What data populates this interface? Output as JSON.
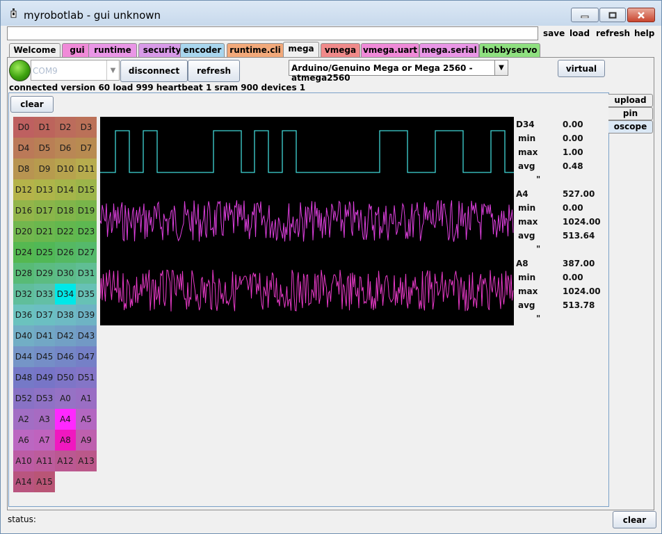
{
  "window": {
    "title": "myrobotlab - gui unknown"
  },
  "toolbar": {
    "command_value": "",
    "save": "save",
    "load": "load",
    "refresh": "refresh",
    "help": "help"
  },
  "tabs": [
    {
      "label": "Welcome",
      "color": "#f0f0f0"
    },
    {
      "label": "gui",
      "color": "#f08ad8"
    },
    {
      "label": "runtime",
      "color": "#e996e6"
    },
    {
      "label": "security",
      "color": "#d89ae8"
    },
    {
      "label": "encoder",
      "color": "#a9d6ee"
    },
    {
      "label": "runtime.cli",
      "color": "#f2a97a"
    },
    {
      "label": "mega",
      "color": "#f0f0f0",
      "active": true
    },
    {
      "label": "vmega",
      "color": "#f08a8a"
    },
    {
      "label": "vmega.uart",
      "color": "#f08ad8"
    },
    {
      "label": "mega.serial",
      "color": "#e996e6"
    },
    {
      "label": "hobbyservo",
      "color": "#8fe080"
    }
  ],
  "controls": {
    "port_value": "COM9",
    "disconnect": "disconnect",
    "refresh": "refresh",
    "board": "Arduino/Genuino Mega or Mega 2560 - atmega2560",
    "virtual": "virtual",
    "status_line": "connected version 60 load 999 heartbeat 1 sram 900 devices 1",
    "clear": "clear"
  },
  "side_tabs": [
    {
      "label": "upload"
    },
    {
      "label": "pin"
    },
    {
      "label": "oscope",
      "active": true
    }
  ],
  "pins": [
    "D0",
    "D1",
    "D2",
    "D3",
    "D4",
    "D5",
    "D6",
    "D7",
    "D8",
    "D9",
    "D10",
    "D11",
    "D12",
    "D13",
    "D14",
    "D15",
    "D16",
    "D17",
    "D18",
    "D19",
    "D20",
    "D21",
    "D22",
    "D23",
    "D24",
    "D25",
    "D26",
    "D27",
    "D28",
    "D29",
    "D30",
    "D31",
    "D32",
    "D33",
    "D34",
    "D35",
    "D36",
    "D37",
    "D38",
    "D39",
    "D40",
    "D41",
    "D42",
    "D43",
    "D44",
    "D45",
    "D46",
    "D47",
    "D48",
    "D49",
    "D50",
    "D51",
    "D52",
    "D53",
    "A0",
    "A1",
    "A2",
    "A3",
    "A4",
    "A5",
    "A6",
    "A7",
    "A8",
    "A9",
    "A10",
    "A11",
    "A12",
    "A13",
    "A14",
    "A15"
  ],
  "highlighted_pins": {
    "D34": "#00e8e8",
    "A4": "#ff28ff",
    "A8": "#f018c0"
  },
  "traces": [
    {
      "pin": "D34",
      "value": "0.00",
      "min_label": "min",
      "min": "0.00",
      "max_label": "max",
      "max": "1.00",
      "avg_label": "avg",
      "avg": "0.48",
      "color": "#40d8d8",
      "marker": "\""
    },
    {
      "pin": "A4",
      "value": "527.00",
      "min_label": "min",
      "min": "0.00",
      "max_label": "max",
      "max": "1024.00",
      "avg_label": "avg",
      "avg": "513.64",
      "color": "#e040e0",
      "marker": "\""
    },
    {
      "pin": "A8",
      "value": "387.00",
      "min_label": "min",
      "min": "0.00",
      "max_label": "max",
      "max": "1024.00",
      "avg_label": "avg",
      "avg": "513.78",
      "color": "#e83ac8",
      "marker": "\""
    }
  ],
  "statusbar": {
    "label": "status:",
    "clear": "clear"
  }
}
